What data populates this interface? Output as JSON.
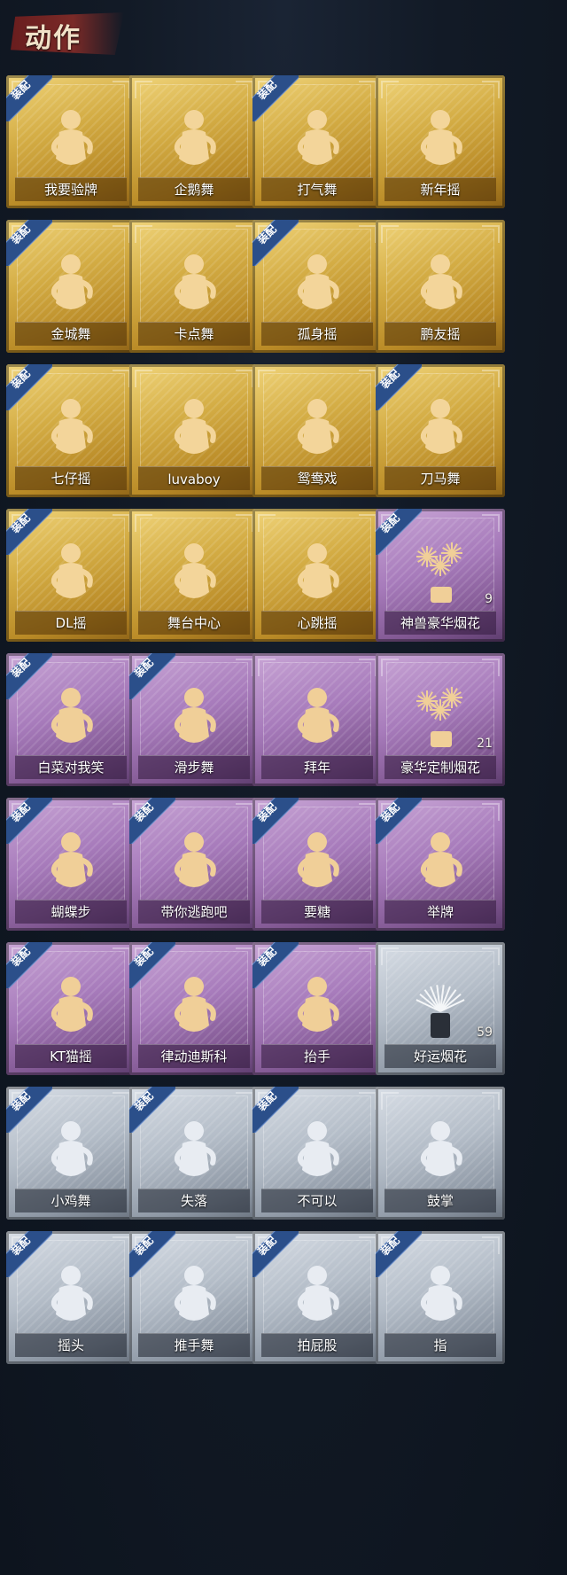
{
  "header": {
    "title": "动作"
  },
  "equip_badge_text": "装配",
  "colors": {
    "gold": "#d4ad45",
    "purple": "#a77bbb",
    "silver": "#b4bdc8",
    "badge": "#2b4f8a"
  },
  "cards": [
    {
      "label": "我要验牌",
      "tier": "gold",
      "equipped": true,
      "icon": "figure-icon"
    },
    {
      "label": "企鹅舞",
      "tier": "gold",
      "equipped": false,
      "icon": "figure-icon"
    },
    {
      "label": "打气舞",
      "tier": "gold",
      "equipped": true,
      "icon": "figure-icon"
    },
    {
      "label": "新年摇",
      "tier": "gold",
      "equipped": false,
      "icon": "figure-icon"
    },
    {
      "label": "金城舞",
      "tier": "gold",
      "equipped": true,
      "icon": "figure-icon"
    },
    {
      "label": "卡点舞",
      "tier": "gold",
      "equipped": false,
      "icon": "figure-icon"
    },
    {
      "label": "孤身摇",
      "tier": "gold",
      "equipped": true,
      "icon": "figure-icon"
    },
    {
      "label": "鹏友摇",
      "tier": "gold",
      "equipped": false,
      "icon": "figure-icon"
    },
    {
      "label": "七仔摇",
      "tier": "gold",
      "equipped": true,
      "icon": "figure-icon"
    },
    {
      "label": "luvaboy",
      "tier": "gold",
      "equipped": false,
      "icon": "figure-icon"
    },
    {
      "label": "鸳鸯戏",
      "tier": "gold",
      "equipped": false,
      "icon": "figure-icon"
    },
    {
      "label": "刀马舞",
      "tier": "gold",
      "equipped": true,
      "icon": "figure-icon"
    },
    {
      "label": "DL摇",
      "tier": "gold",
      "equipped": true,
      "icon": "figure-icon"
    },
    {
      "label": "舞台中心",
      "tier": "gold",
      "equipped": false,
      "icon": "figure-icon"
    },
    {
      "label": "心跳摇",
      "tier": "gold",
      "equipped": false,
      "icon": "figure-icon"
    },
    {
      "label": "神兽豪华烟花",
      "tier": "purple",
      "equipped": true,
      "icon": "fireworks-icon",
      "count": "9"
    },
    {
      "label": "白菜对我笑",
      "tier": "purple",
      "equipped": true,
      "icon": "figure-icon"
    },
    {
      "label": "滑步舞",
      "tier": "purple",
      "equipped": true,
      "icon": "figure-icon"
    },
    {
      "label": "拜年",
      "tier": "purple",
      "equipped": false,
      "icon": "figure-icon"
    },
    {
      "label": "豪华定制烟花",
      "tier": "purple",
      "equipped": false,
      "icon": "fireworks-icon",
      "count": "21"
    },
    {
      "label": "蝴蝶步",
      "tier": "purple",
      "equipped": true,
      "icon": "figure-icon"
    },
    {
      "label": "带你逃跑吧",
      "tier": "purple",
      "equipped": true,
      "icon": "figure-icon"
    },
    {
      "label": "要糖",
      "tier": "purple",
      "equipped": true,
      "icon": "figure-icon"
    },
    {
      "label": "举牌",
      "tier": "purple",
      "equipped": true,
      "icon": "figure-icon"
    },
    {
      "label": "KT猫摇",
      "tier": "purple",
      "equipped": true,
      "icon": "figure-icon"
    },
    {
      "label": "律动迪斯科",
      "tier": "purple",
      "equipped": true,
      "icon": "figure-icon"
    },
    {
      "label": "抬手",
      "tier": "purple",
      "equipped": true,
      "icon": "figure-icon"
    },
    {
      "label": "好运烟花",
      "tier": "silver",
      "equipped": false,
      "icon": "firework-can-icon",
      "count": "59"
    },
    {
      "label": "小鸡舞",
      "tier": "silver",
      "equipped": true,
      "icon": "figure-icon"
    },
    {
      "label": "失落",
      "tier": "silver",
      "equipped": true,
      "icon": "figure-icon"
    },
    {
      "label": "不可以",
      "tier": "silver",
      "equipped": true,
      "icon": "figure-icon"
    },
    {
      "label": "鼓掌",
      "tier": "silver",
      "equipped": false,
      "icon": "figure-icon"
    },
    {
      "label": "摇头",
      "tier": "silver",
      "equipped": true,
      "icon": "figure-icon"
    },
    {
      "label": "推手舞",
      "tier": "silver",
      "equipped": true,
      "icon": "figure-icon"
    },
    {
      "label": "拍屁股",
      "tier": "silver",
      "equipped": true,
      "icon": "figure-icon"
    },
    {
      "label": "指",
      "tier": "silver",
      "equipped": true,
      "icon": "figure-icon"
    }
  ]
}
